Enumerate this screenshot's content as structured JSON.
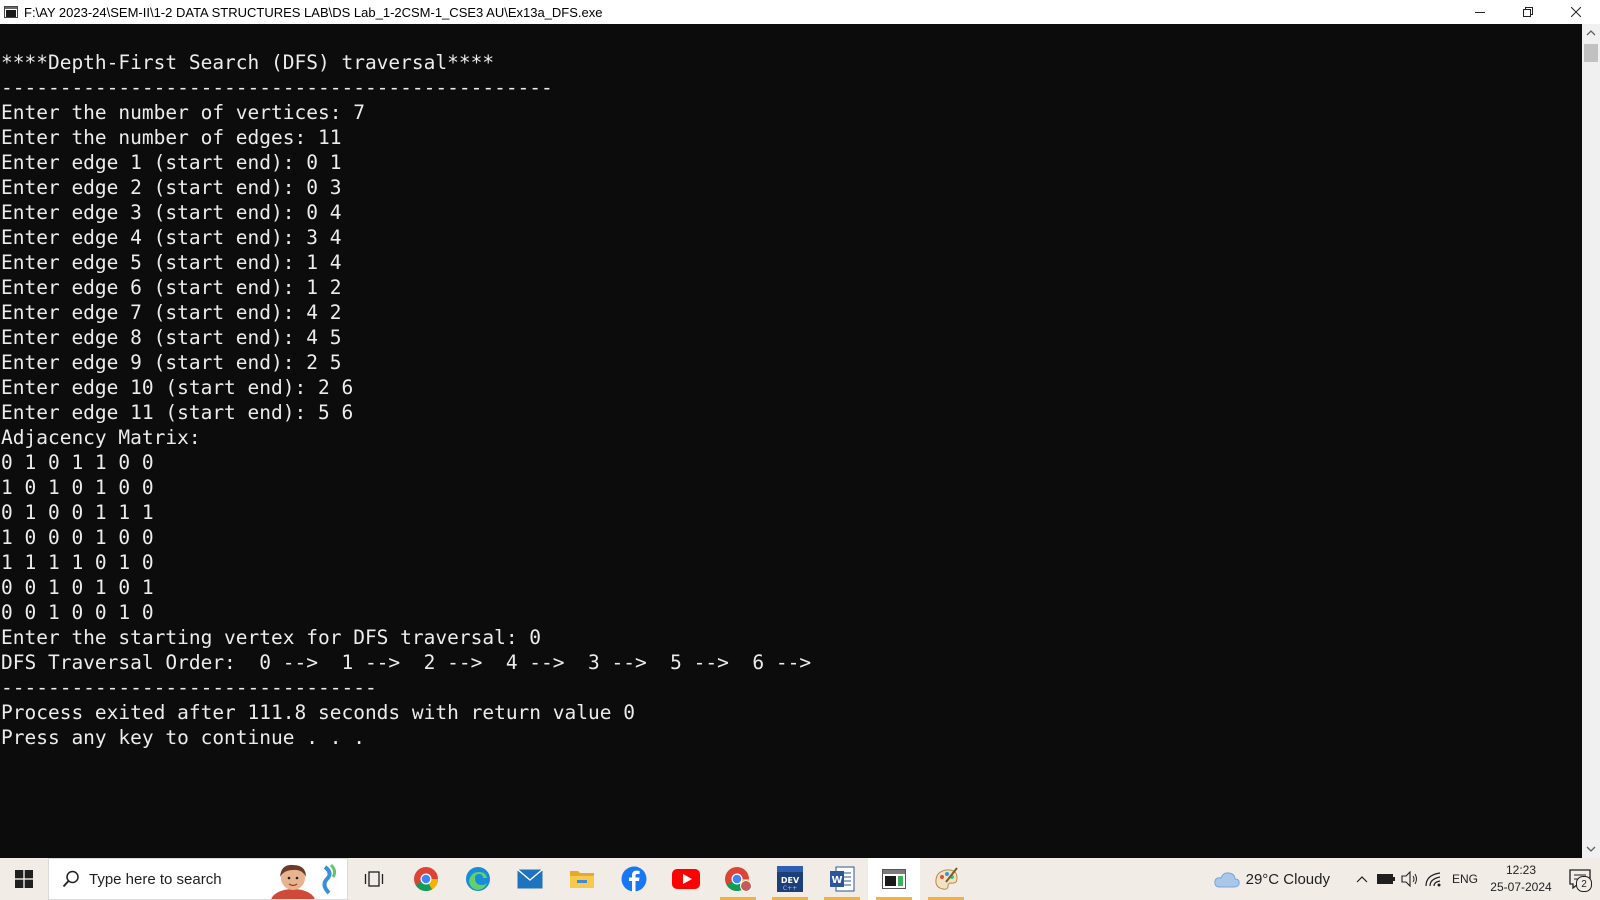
{
  "window": {
    "title": "F:\\AY 2023-24\\SEM-II\\1-2 DATA STRUCTURES LAB\\DS Lab_1-2CSM-1_CSE3 AU\\Ex13a_DFS.exe"
  },
  "console": {
    "lines": [
      "****Depth-First Search (DFS) traversal****",
      "-----------------------------------------------",
      "Enter the number of vertices: 7",
      "Enter the number of edges: 11",
      "Enter edge 1 (start end): 0 1",
      "Enter edge 2 (start end): 0 3",
      "Enter edge 3 (start end): 0 4",
      "Enter edge 4 (start end): 3 4",
      "Enter edge 5 (start end): 1 4",
      "Enter edge 6 (start end): 1 2",
      "Enter edge 7 (start end): 4 2",
      "Enter edge 8 (start end): 4 5",
      "Enter edge 9 (start end): 2 5",
      "Enter edge 10 (start end): 2 6",
      "Enter edge 11 (start end): 5 6",
      "Adjacency Matrix:",
      "0 1 0 1 1 0 0",
      "1 0 1 0 1 0 0",
      "0 1 0 0 1 1 1",
      "1 0 0 0 1 0 0",
      "1 1 1 1 0 1 0",
      "0 0 1 0 1 0 1",
      "0 0 1 0 0 1 0",
      "Enter the starting vertex for DFS traversal: 0",
      "DFS Traversal Order:  0 -->  1 -->  2 -->  4 -->  3 -->  5 -->  6 -->",
      "--------------------------------",
      "Process exited after 111.8 seconds with return value 0",
      "Press any key to continue . . ."
    ]
  },
  "taskbar": {
    "search_placeholder": "Type here to search",
    "weather": "29°C  Cloudy",
    "language": "ENG",
    "time": "12:23",
    "date": "25-07-2024",
    "notification_count": "2"
  }
}
